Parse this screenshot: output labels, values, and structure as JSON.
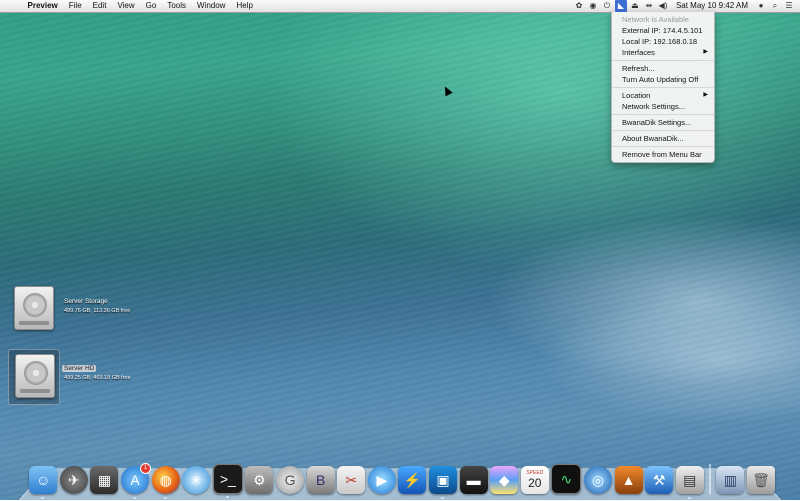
{
  "menubar": {
    "app_name": "Preview",
    "menus": [
      "File",
      "Edit",
      "View",
      "Go",
      "Tools",
      "Window",
      "Help"
    ],
    "status_icons": [
      "status-app-icon",
      "eye-icon",
      "bwanadik-icon",
      "eject-icon",
      "wifi-icon",
      "volume-icon"
    ],
    "clock": "Sat May 10  9:42 AM"
  },
  "dropdown": {
    "status": "Network is Available",
    "external_ip": "External IP: 174.4.5.101",
    "local_ip": "Local IP: 192.168.0.18",
    "interfaces": "Interfaces",
    "refresh": "Refresh...",
    "auto_update": "Turn Auto Updating Off",
    "location": "Location",
    "network_settings": "Network Settings...",
    "app_settings": "BwanaDik Settings...",
    "about": "About BwanaDik...",
    "remove": "Remove from Menu Bar"
  },
  "drives": [
    {
      "name": "Server Storage",
      "info": "499.76 GB, 113.36 GB free"
    },
    {
      "name": "Server HD",
      "info": "499.25 GB, 469.18 GB free"
    }
  ],
  "dock": {
    "calendar_month": "SPEED",
    "calendar_day": "20",
    "notification_badge": "1"
  },
  "colors": {
    "menu_highlight": "#3d6fd6",
    "badge": "#e23b2f"
  }
}
